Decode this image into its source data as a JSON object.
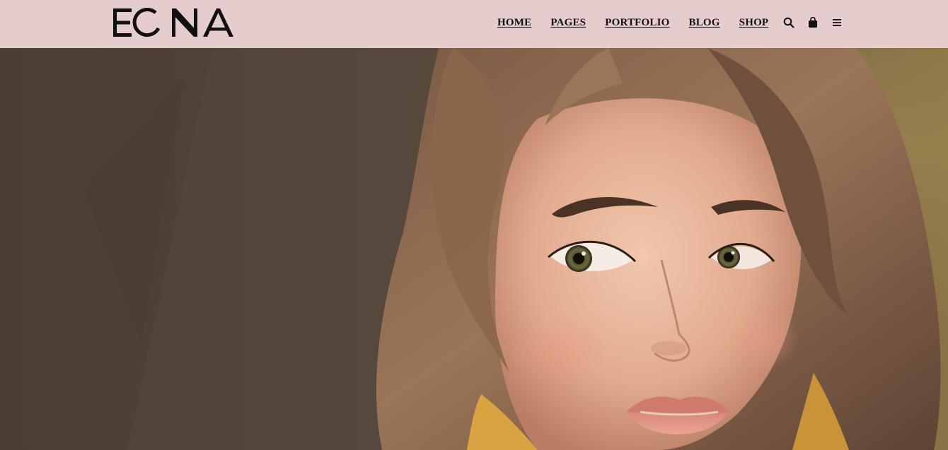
{
  "header": {
    "logo_text": "EONA",
    "background_color": "#e6cdcd",
    "nav": [
      {
        "label": "HOME"
      },
      {
        "label": "PAGES"
      },
      {
        "label": "PORTFOLIO"
      },
      {
        "label": "BLOG"
      },
      {
        "label": "SHOP"
      }
    ],
    "icons": [
      "search-icon",
      "shopping-bag-icon",
      "menu-icon"
    ]
  },
  "hero": {
    "image_subject": "portrait-photo"
  }
}
